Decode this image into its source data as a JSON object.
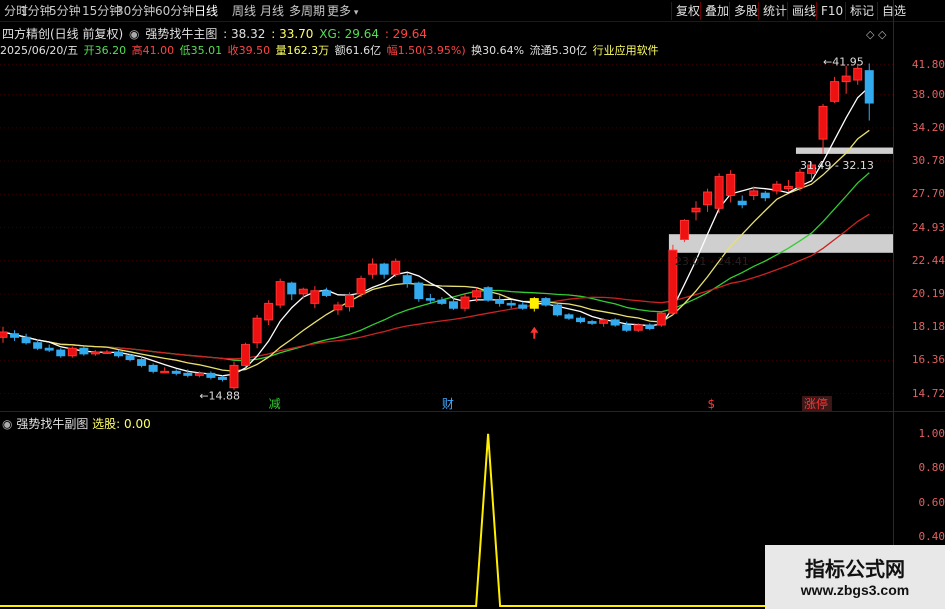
{
  "toolbar": {
    "timeframes": [
      "分时",
      "1分钟",
      "5分钟",
      "15分钟",
      "30分钟",
      "60分钟",
      "日线",
      "周线",
      "月线",
      "多周期",
      "更多"
    ],
    "active_timeframe": "日线",
    "right_buttons": [
      "复权",
      "叠加",
      "多股",
      "统计",
      "画线",
      "F10",
      "标记",
      "自选"
    ]
  },
  "header": {
    "stock_name": "四方精创(日线 前复权)",
    "indicator_name": "强势找牛主图",
    "ind_values": [
      ": 38.32",
      ": 33.70",
      "XG: 29.64",
      ": 29.64"
    ],
    "date": "2025/06/20/五",
    "open": "开36.20",
    "high": "高41.00",
    "low": "低35.01",
    "close": "收39.50",
    "volume": "量162.3万",
    "amount": "额61.6亿",
    "change": "幅1.50(3.95%)",
    "turnover": "换30.64%",
    "float_cap": "流通5.30亿",
    "industry": "行业应用软件"
  },
  "sub_panel": {
    "title": "强势找牛副图",
    "label": "选股: 0.00"
  },
  "price_axis": [
    "41.80",
    "38.00",
    "34.20",
    "30.78",
    "27.70",
    "24.93",
    "22.44",
    "20.19",
    "18.18",
    "16.36",
    "14.72"
  ],
  "sub_axis": [
    "1.00",
    "0.80",
    "0.60",
    "0.40"
  ],
  "annotations": {
    "low_mark": "14.88",
    "high_mark": "41.95",
    "zone1": "23.01 - 24.41",
    "zone2": "31.49 - 32.13",
    "tags": [
      "减",
      "财",
      "$",
      "涨停"
    ]
  },
  "chart_data": {
    "type": "candlestick",
    "title": "强势找牛主图",
    "y_scale": "log",
    "ylim": [
      14.2,
      43.5
    ],
    "candles": [
      {
        "o": 17.6,
        "h": 18.2,
        "l": 17.3,
        "c": 17.9
      },
      {
        "o": 17.8,
        "h": 18.0,
        "l": 17.4,
        "c": 17.6
      },
      {
        "o": 17.6,
        "h": 17.8,
        "l": 17.2,
        "c": 17.3
      },
      {
        "o": 17.3,
        "h": 17.5,
        "l": 16.9,
        "c": 17.0
      },
      {
        "o": 17.0,
        "h": 17.2,
        "l": 16.8,
        "c": 16.9
      },
      {
        "o": 16.9,
        "h": 17.0,
        "l": 16.5,
        "c": 16.6
      },
      {
        "o": 16.6,
        "h": 17.1,
        "l": 16.5,
        "c": 17.0
      },
      {
        "o": 17.0,
        "h": 17.1,
        "l": 16.6,
        "c": 16.7
      },
      {
        "o": 16.7,
        "h": 16.9,
        "l": 16.6,
        "c": 16.8
      },
      {
        "o": 16.8,
        "h": 16.9,
        "l": 16.7,
        "c": 16.8
      },
      {
        "o": 16.8,
        "h": 16.9,
        "l": 16.5,
        "c": 16.6
      },
      {
        "o": 16.6,
        "h": 16.7,
        "l": 16.3,
        "c": 16.4
      },
      {
        "o": 16.4,
        "h": 16.6,
        "l": 16.0,
        "c": 16.1
      },
      {
        "o": 16.1,
        "h": 16.2,
        "l": 15.7,
        "c": 15.8
      },
      {
        "o": 15.8,
        "h": 16.0,
        "l": 15.7,
        "c": 15.8
      },
      {
        "o": 15.8,
        "h": 15.9,
        "l": 15.6,
        "c": 15.7
      },
      {
        "o": 15.7,
        "h": 15.9,
        "l": 15.5,
        "c": 15.6
      },
      {
        "o": 15.6,
        "h": 15.8,
        "l": 15.5,
        "c": 15.7
      },
      {
        "o": 15.7,
        "h": 15.8,
        "l": 15.4,
        "c": 15.5
      },
      {
        "o": 15.5,
        "h": 15.6,
        "l": 15.3,
        "c": 15.4
      },
      {
        "o": 15.0,
        "h": 16.3,
        "l": 14.9,
        "c": 16.1
      },
      {
        "o": 16.1,
        "h": 17.3,
        "l": 16.0,
        "c": 17.2
      },
      {
        "o": 17.3,
        "h": 18.9,
        "l": 17.0,
        "c": 18.7
      },
      {
        "o": 18.6,
        "h": 19.8,
        "l": 18.3,
        "c": 19.6
      },
      {
        "o": 19.5,
        "h": 21.2,
        "l": 19.3,
        "c": 21.0
      },
      {
        "o": 20.9,
        "h": 21.0,
        "l": 19.8,
        "c": 20.2
      },
      {
        "o": 20.2,
        "h": 20.6,
        "l": 19.9,
        "c": 20.5
      },
      {
        "o": 19.6,
        "h": 20.7,
        "l": 19.3,
        "c": 20.4
      },
      {
        "o": 20.4,
        "h": 20.6,
        "l": 20.0,
        "c": 20.1
      },
      {
        "o": 19.2,
        "h": 19.7,
        "l": 18.9,
        "c": 19.5
      },
      {
        "o": 19.4,
        "h": 20.3,
        "l": 19.1,
        "c": 20.1
      },
      {
        "o": 20.2,
        "h": 21.4,
        "l": 20.0,
        "c": 21.2
      },
      {
        "o": 21.5,
        "h": 22.6,
        "l": 21.2,
        "c": 22.2
      },
      {
        "o": 22.2,
        "h": 22.3,
        "l": 21.2,
        "c": 21.5
      },
      {
        "o": 21.5,
        "h": 22.6,
        "l": 21.3,
        "c": 22.4
      },
      {
        "o": 21.4,
        "h": 21.6,
        "l": 20.6,
        "c": 20.9
      },
      {
        "o": 20.9,
        "h": 21.0,
        "l": 19.7,
        "c": 19.9
      },
      {
        "o": 19.9,
        "h": 20.2,
        "l": 19.6,
        "c": 19.8
      },
      {
        "o": 19.8,
        "h": 20.0,
        "l": 19.5,
        "c": 19.6
      },
      {
        "o": 19.7,
        "h": 20.0,
        "l": 19.2,
        "c": 19.3
      },
      {
        "o": 19.3,
        "h": 20.2,
        "l": 19.1,
        "c": 20.0
      },
      {
        "o": 20.0,
        "h": 20.6,
        "l": 19.7,
        "c": 20.4
      },
      {
        "o": 20.6,
        "h": 20.7,
        "l": 19.7,
        "c": 19.8
      },
      {
        "o": 19.8,
        "h": 20.1,
        "l": 19.4,
        "c": 19.6
      },
      {
        "o": 19.6,
        "h": 19.8,
        "l": 19.3,
        "c": 19.5
      },
      {
        "o": 19.5,
        "h": 19.7,
        "l": 19.2,
        "c": 19.3
      },
      {
        "o": 19.3,
        "h": 20.0,
        "l": 19.1,
        "c": 19.9
      },
      {
        "o": 19.9,
        "h": 20.0,
        "l": 19.4,
        "c": 19.5
      },
      {
        "o": 19.5,
        "h": 19.6,
        "l": 18.8,
        "c": 18.9
      },
      {
        "o": 18.9,
        "h": 19.0,
        "l": 18.6,
        "c": 18.7
      },
      {
        "o": 18.7,
        "h": 18.8,
        "l": 18.4,
        "c": 18.5
      },
      {
        "o": 18.5,
        "h": 18.6,
        "l": 18.3,
        "c": 18.4
      },
      {
        "o": 18.4,
        "h": 18.7,
        "l": 18.2,
        "c": 18.6
      },
      {
        "o": 18.6,
        "h": 18.7,
        "l": 18.2,
        "c": 18.3
      },
      {
        "o": 18.3,
        "h": 18.5,
        "l": 17.9,
        "c": 18.0
      },
      {
        "o": 18.0,
        "h": 18.4,
        "l": 17.9,
        "c": 18.3
      },
      {
        "o": 18.3,
        "h": 18.4,
        "l": 18.0,
        "c": 18.1
      },
      {
        "o": 18.3,
        "h": 19.1,
        "l": 18.2,
        "c": 19.0
      },
      {
        "o": 19.0,
        "h": 23.6,
        "l": 18.9,
        "c": 23.2
      },
      {
        "o": 24.0,
        "h": 25.6,
        "l": 23.8,
        "c": 25.5
      },
      {
        "o": 26.2,
        "h": 27.1,
        "l": 25.5,
        "c": 26.5
      },
      {
        "o": 26.8,
        "h": 28.2,
        "l": 26.2,
        "c": 27.9
      },
      {
        "o": 26.5,
        "h": 29.6,
        "l": 26.1,
        "c": 29.3
      },
      {
        "o": 27.6,
        "h": 29.9,
        "l": 27.0,
        "c": 29.5
      },
      {
        "o": 27.1,
        "h": 27.6,
        "l": 26.5,
        "c": 26.8
      },
      {
        "o": 27.6,
        "h": 28.4,
        "l": 27.2,
        "c": 28.0
      },
      {
        "o": 27.8,
        "h": 28.0,
        "l": 27.1,
        "c": 27.4
      },
      {
        "o": 28.0,
        "h": 28.9,
        "l": 27.7,
        "c": 28.6
      },
      {
        "o": 28.2,
        "h": 29.0,
        "l": 27.9,
        "c": 28.4
      },
      {
        "o": 28.3,
        "h": 30.0,
        "l": 28.0,
        "c": 29.7
      },
      {
        "o": 29.6,
        "h": 30.7,
        "l": 29.1,
        "c": 30.4
      },
      {
        "o": 33.0,
        "h": 36.9,
        "l": 31.5,
        "c": 36.6
      },
      {
        "o": 37.2,
        "h": 40.2,
        "l": 37.0,
        "c": 39.6
      },
      {
        "o": 39.6,
        "h": 41.6,
        "l": 38.1,
        "c": 40.3
      },
      {
        "o": 39.8,
        "h": 41.9,
        "l": 39.2,
        "c": 41.3
      },
      {
        "o": 41.0,
        "h": 41.95,
        "l": 35.0,
        "c": 37.0
      }
    ],
    "sub_series": {
      "name": "选股",
      "signal_index": 42,
      "ylim": [
        0,
        1.08
      ]
    }
  }
}
